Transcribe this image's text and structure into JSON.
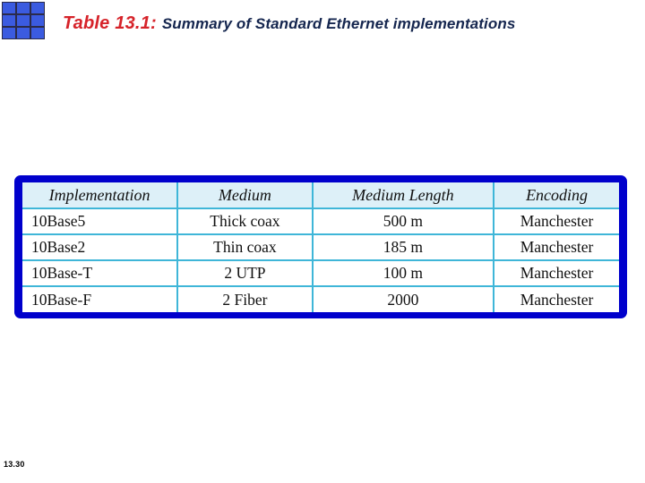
{
  "logo": {
    "name": "grid-logo",
    "cells": 9,
    "cell_color": "#3b5be0",
    "frame_color": "#2b2b4a"
  },
  "title": {
    "lead": "Table 13.1:",
    "lead_color": "#d6232a",
    "rest": "Summary of Standard Ethernet implementations",
    "rest_color": "#15264f"
  },
  "table": {
    "frame_color": "#0000cc",
    "header_bg": "#ddf0f8",
    "grid_color": "#3fb6d8",
    "columns": [
      "Implementation",
      "Medium",
      "Medium Length",
      "Encoding"
    ],
    "rows": [
      {
        "implementation": "10Base5",
        "medium": "Thick coax",
        "medium_length": "500 m",
        "encoding": "Manchester"
      },
      {
        "implementation": "10Base2",
        "medium": "Thin coax",
        "medium_length": "185 m",
        "encoding": "Manchester"
      },
      {
        "implementation": "10Base-T",
        "medium": "2 UTP",
        "medium_length": "100 m",
        "encoding": "Manchester"
      },
      {
        "implementation": "10Base-F",
        "medium": "2 Fiber",
        "medium_length": "2000",
        "encoding": "Manchester"
      }
    ]
  },
  "footer": {
    "page_number": "13.30"
  }
}
